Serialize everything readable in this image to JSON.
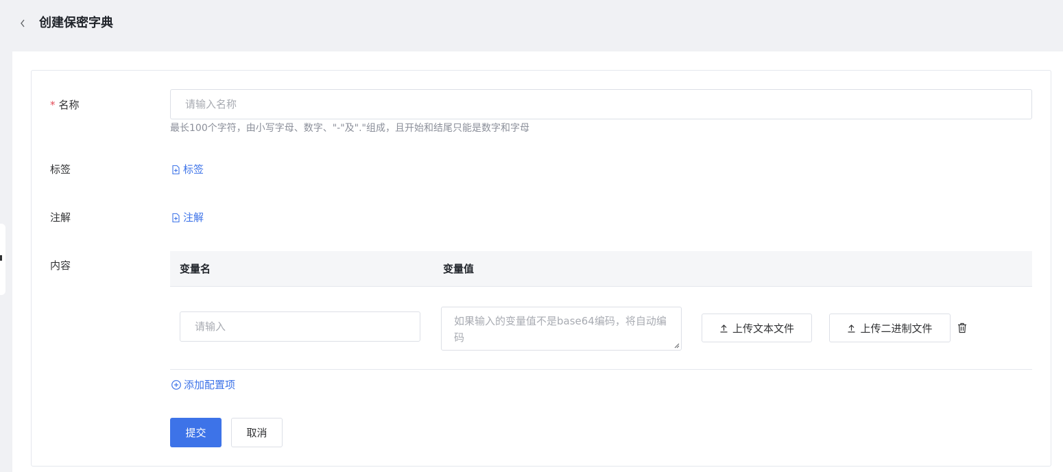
{
  "header": {
    "title": "创建保密字典",
    "back_icon": "chevron-left-icon"
  },
  "form": {
    "name": {
      "required_mark": "*",
      "label": "名称",
      "placeholder": "请输入名称",
      "value": "",
      "help": "最长100个字符，由小写字母、数字、\"-\"及\".\"组成，且开始和结尾只能是数字和字母"
    },
    "labels": {
      "label": "标签",
      "add_link": "标签",
      "add_icon": "file-plus-icon"
    },
    "annotations": {
      "label": "注解",
      "add_link": "注解",
      "add_icon": "file-plus-icon"
    },
    "content": {
      "label": "内容",
      "columns": [
        "变量名",
        "变量值"
      ],
      "rows": [
        {
          "key_placeholder": "请输入",
          "key_value": "",
          "value_placeholder": "如果输入的变量值不是base64编码，将自动编码",
          "value_value": "",
          "upload_text_label": "上传文本文件",
          "upload_binary_label": "上传二进制文件",
          "upload_icon": "upload-icon",
          "delete_icon": "trash-icon"
        }
      ],
      "add_item_label": "添加配置项",
      "add_item_icon": "circle-plus-icon"
    }
  },
  "actions": {
    "submit_label": "提交",
    "cancel_label": "取消"
  },
  "colors": {
    "primary": "#3d73e8",
    "required": "#e34d59",
    "background": "#f0f1f4"
  }
}
